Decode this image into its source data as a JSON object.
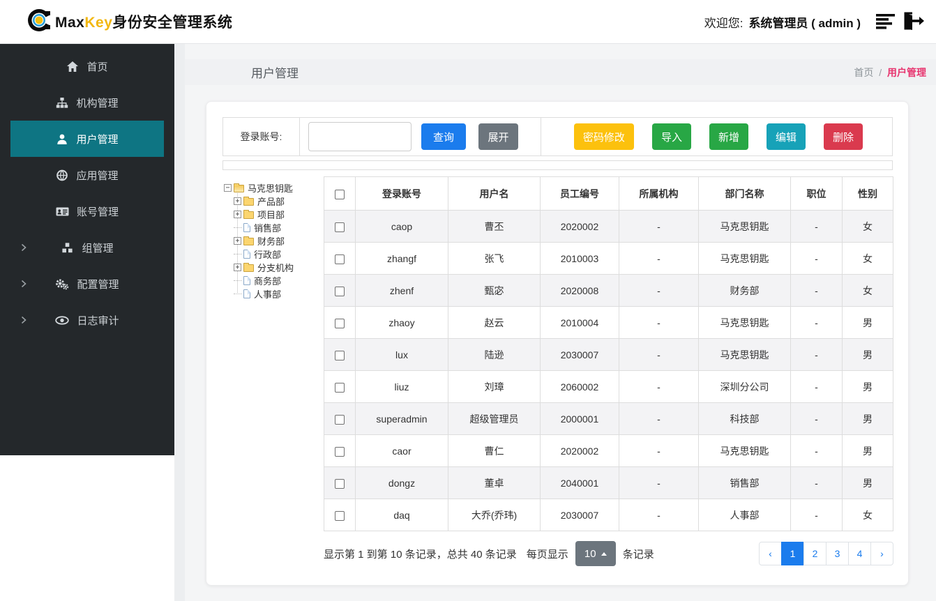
{
  "navbar": {
    "brand_max": "Max",
    "brand_key": "Key",
    "brand_rest": "身份安全管理系统",
    "welcome_label": "欢迎您:",
    "user": "系统管理员 ( admin )"
  },
  "colors": {
    "accent_blue": "#1b7ced",
    "sidebar_bg": "#24282b",
    "sidebar_active": "#0e7583",
    "breadcrumb_current": "#e7356f",
    "brand_key": "#f2b711"
  },
  "sidebar": {
    "items": [
      {
        "id": "home",
        "label": "首页",
        "icon": "home-icon",
        "active": false,
        "chevron": false
      },
      {
        "id": "org",
        "label": "机构管理",
        "icon": "sitemap-icon",
        "active": false,
        "chevron": false
      },
      {
        "id": "user",
        "label": "用户管理",
        "icon": "user-icon",
        "active": true,
        "chevron": false
      },
      {
        "id": "app",
        "label": "应用管理",
        "icon": "globe-icon",
        "active": false,
        "chevron": false
      },
      {
        "id": "account",
        "label": "账号管理",
        "icon": "idcard-icon",
        "active": false,
        "chevron": false
      },
      {
        "id": "group",
        "label": "组管理",
        "icon": "cubes-icon",
        "active": false,
        "chevron": true
      },
      {
        "id": "config",
        "label": "配置管理",
        "icon": "gears-icon",
        "active": false,
        "chevron": true
      },
      {
        "id": "audit",
        "label": "日志审计",
        "icon": "eye-icon",
        "active": false,
        "chevron": true
      }
    ]
  },
  "page": {
    "title": "用户管理",
    "breadcrumb": {
      "home": "首页",
      "sep": "/",
      "current": "用户管理"
    }
  },
  "search": {
    "label": "登录账号:",
    "input_value": "",
    "query_label": "查询",
    "expand_label": "展开"
  },
  "actions": [
    {
      "id": "password",
      "label": "密码修改",
      "color": "#fcc10d"
    },
    {
      "id": "import",
      "label": "导入",
      "color": "#28a745"
    },
    {
      "id": "add",
      "label": "新增",
      "color": "#28a745"
    },
    {
      "id": "edit",
      "label": "编辑",
      "color": "#17a2b8"
    },
    {
      "id": "delete",
      "label": "删除",
      "color": "#da3a4e"
    }
  ],
  "tree": {
    "root": {
      "label": "马克思钥匙",
      "expander": "minus",
      "icon": "folder-open-icon"
    },
    "children": [
      {
        "label": "产品部",
        "expander": "plus",
        "icon": "folder-icon"
      },
      {
        "label": "项目部",
        "expander": "plus",
        "icon": "folder-icon"
      },
      {
        "label": "销售部",
        "expander": "none",
        "icon": "file-icon"
      },
      {
        "label": "财务部",
        "expander": "plus",
        "icon": "folder-icon"
      },
      {
        "label": "行政部",
        "expander": "none",
        "icon": "file-icon"
      },
      {
        "label": "分支机构",
        "expander": "plus",
        "icon": "folder-icon"
      },
      {
        "label": "商务部",
        "expander": "none",
        "icon": "file-icon"
      },
      {
        "label": "人事部",
        "expander": "none",
        "icon": "file-icon"
      }
    ]
  },
  "table": {
    "columns": [
      "登录账号",
      "用户名",
      "员工编号",
      "所属机构",
      "部门名称",
      "职位",
      "性别"
    ],
    "rows": [
      [
        "caop",
        "曹丕",
        "2020002",
        "-",
        "马克思钥匙",
        "-",
        "女"
      ],
      [
        "zhangf",
        "张飞",
        "2010003",
        "-",
        "马克思钥匙",
        "-",
        "女"
      ],
      [
        "zhenf",
        "甄宓",
        "2020008",
        "-",
        "财务部",
        "-",
        "女"
      ],
      [
        "zhaoy",
        "赵云",
        "2010004",
        "-",
        "马克思钥匙",
        "-",
        "男"
      ],
      [
        "lux",
        "陆逊",
        "2030007",
        "-",
        "马克思钥匙",
        "-",
        "男"
      ],
      [
        "liuz",
        "刘璋",
        "2060002",
        "-",
        "深圳分公司",
        "-",
        "男"
      ],
      [
        "superadmin",
        "超级管理员",
        "2000001",
        "-",
        "科技部",
        "-",
        "男"
      ],
      [
        "caor",
        "曹仁",
        "2020002",
        "-",
        "马克思钥匙",
        "-",
        "男"
      ],
      [
        "dongz",
        "董卓",
        "2040001",
        "-",
        "销售部",
        "-",
        "男"
      ],
      [
        "daq",
        "大乔(乔玮)",
        "2030007",
        "-",
        "人事部",
        "-",
        "女"
      ]
    ]
  },
  "pagination": {
    "info": "显示第 1 到第 10 条记录，总共 40 条记录",
    "per_page_label": "每页显示",
    "page_size": "10",
    "suffix": "条记录",
    "prev": "‹",
    "next": "›",
    "pages": [
      "1",
      "2",
      "3",
      "4"
    ],
    "active_page": "1"
  }
}
